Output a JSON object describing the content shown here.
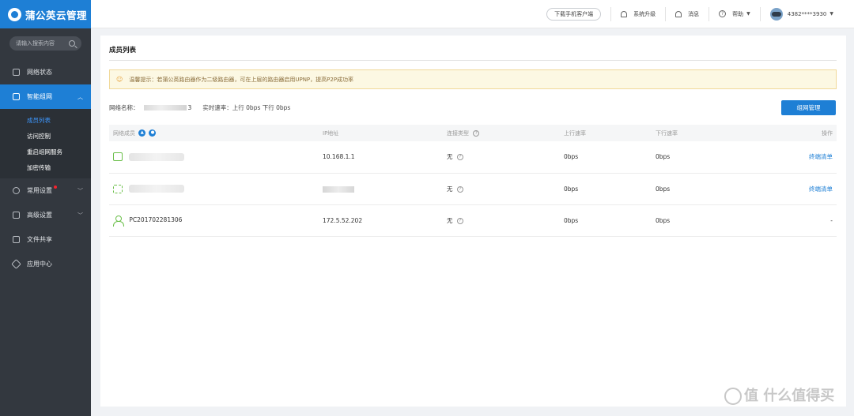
{
  "app": {
    "title": "蒲公英云管理"
  },
  "sidebar": {
    "search_placeholder": "请输入搜索内容",
    "items": [
      {
        "label": "网络状态",
        "icon": "network-status-icon"
      },
      {
        "label": "智能组网",
        "icon": "smart-network-icon",
        "active": true,
        "children": [
          {
            "label": "成员列表",
            "active": true
          },
          {
            "label": "访问控制"
          },
          {
            "label": "重启组网服务"
          },
          {
            "label": "加密传输"
          }
        ]
      },
      {
        "label": "常用设置",
        "icon": "gear-icon",
        "has_badge": true
      },
      {
        "label": "高级设置",
        "icon": "advanced-settings-icon"
      },
      {
        "label": "文件共享",
        "icon": "folder-icon"
      },
      {
        "label": "应用中心",
        "icon": "app-center-icon"
      }
    ]
  },
  "topbar": {
    "download_label": "下载手机客户端",
    "upgrade_label": "系统升级",
    "messages_label": "消息",
    "help_label": "帮助",
    "user_id": "4382****3930"
  },
  "panel": {
    "title": "成员列表",
    "notice": "温馨提示：若蒲公英路由器作为二级路由器，可在上层的路由器启用UPNP，提高P2P成功率",
    "network_name_label": "网络名称：",
    "network_name_suffix": "3",
    "realtime_rate_label": "实时速率：",
    "realtime_rate_value": "上行 0bps 下行 0bps",
    "manage_button": "组网管理"
  },
  "table": {
    "columns": [
      "网络成员",
      "IP地址",
      "连接类型",
      "上行速率",
      "下行速率",
      "操作"
    ],
    "member_badges": [
      "LAN",
      "USER"
    ],
    "rows": [
      {
        "member": "",
        "member_icon": "router-icon",
        "ip": "10.168.1.1",
        "type": "无",
        "up": "0bps",
        "down": "0bps",
        "action": "终端清单"
      },
      {
        "member": "",
        "member_icon": "router-icon",
        "ip": "",
        "type": "无",
        "up": "0bps",
        "down": "0bps",
        "action": "终端清单"
      },
      {
        "member": "PC201702281306",
        "member_icon": "user-icon",
        "ip": "172.5.52.202",
        "type": "无",
        "up": "0bps",
        "down": "0bps",
        "action": "-"
      }
    ]
  },
  "watermark": "值 什么值得买",
  "colors": {
    "accent": "#1e7fd5",
    "sidebar_bg": "#33383f",
    "notice_bg": "#fcf8e3",
    "icon_green": "#6bbf4a"
  }
}
